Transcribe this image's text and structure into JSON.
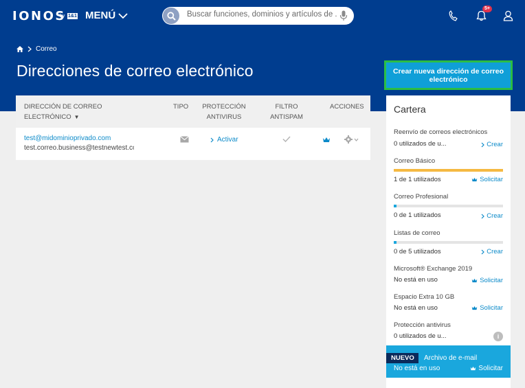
{
  "header": {
    "logo": "IONOS",
    "logo_by": "by",
    "logo_badge": "1&1",
    "menu_label": "MENÚ",
    "search_placeholder": "Buscar funciones, dominios y artículos de ...",
    "notification_count": "5+"
  },
  "breadcrumb": {
    "item": "Correo"
  },
  "page": {
    "title": "Direcciones de correo electrónico",
    "create_button": "Crear nueva dirección de correo electrónico"
  },
  "table": {
    "columns": {
      "address": "DIRECCIÓN DE CORREO ELECTRÓNICO",
      "type": "TIPO",
      "antivirus": "PROTECCIÓN ANTIVIRUS",
      "antispam": "FILTRO ANTISPAM",
      "actions": "ACCIONES"
    },
    "rows": [
      {
        "email": "test@midominioprivado.com",
        "alias": "test.correo.business@testnewtest.com",
        "antivirus_action": "Activar",
        "type_icon": "envelope-icon",
        "antispam_icon": "check-icon",
        "actions_icon": "gear-icon"
      }
    ]
  },
  "cartera": {
    "title": "Cartera",
    "items": [
      {
        "label": "Reenvío de correos electrónicos",
        "value": "0 utilizados de u...",
        "action": "Crear",
        "action_icon": "chevron-right-icon"
      },
      {
        "label": "Correo Básico",
        "value": "1 de 1 utilizados",
        "action": "Solicitar",
        "action_icon": "crown-icon",
        "progress": 1.0,
        "bar_color": "#f5b942"
      },
      {
        "label": "Correo Profesional",
        "value": "0 de 1 utilizados",
        "action": "Crear",
        "action_icon": "chevron-right-icon",
        "progress": 0.0,
        "bar_color": "#1aa7dd"
      },
      {
        "label": "Listas de correo",
        "value": "0 de 5 utilizados",
        "action": "Crear",
        "action_icon": "chevron-right-icon",
        "progress": 0.0,
        "bar_color": "#1aa7dd"
      },
      {
        "label": "Microsoft® Exchange 2019",
        "value": "No está en uso",
        "action": "Solicitar",
        "action_icon": "crown-icon"
      },
      {
        "label": "Espacio Extra 10 GB",
        "value": "No está en uso",
        "action": "Solicitar",
        "action_icon": "crown-icon"
      },
      {
        "label": "Protección antivirus",
        "value": "0 utilizados de u...",
        "action": "",
        "action_icon": "info-icon"
      }
    ],
    "promo": {
      "badge": "NUEVO",
      "label": "Archivo de e-mail",
      "value": "No está en uso",
      "action": "Solicitar"
    }
  },
  "colors": {
    "brand_dark": "#003d8f",
    "accent": "#0f9fd8",
    "link": "#0b8ac9",
    "highlight_border": "#2bbd44",
    "notification": "#e0334d"
  }
}
